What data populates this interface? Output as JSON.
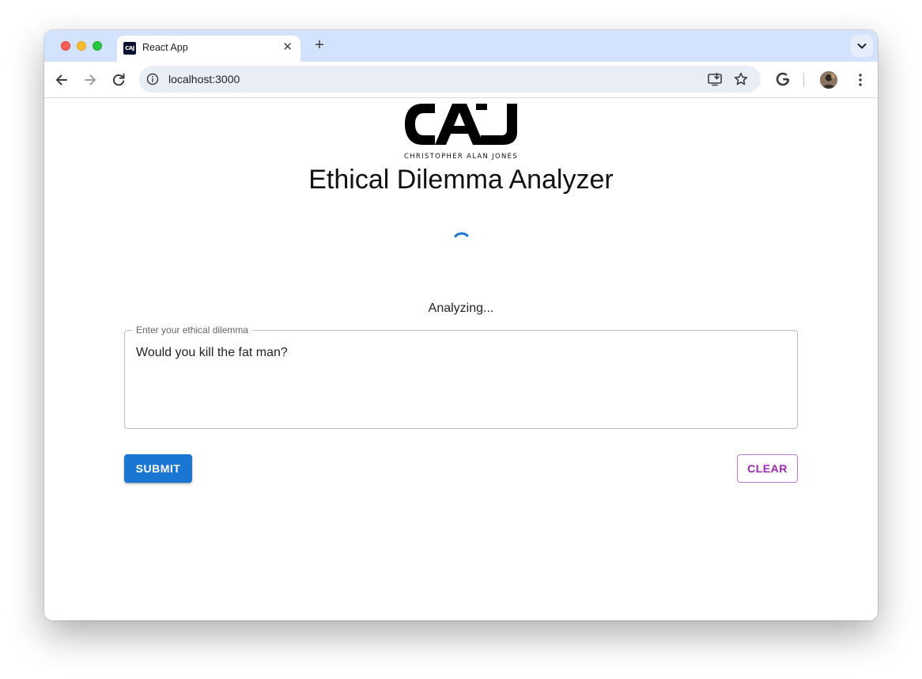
{
  "browser": {
    "tab_title": "React App",
    "tab_favicon_text": "CAJ",
    "close_symbol": "✕",
    "new_tab_symbol": "+",
    "url": "localhost:3000"
  },
  "app": {
    "logo_text": "CAJ",
    "logo_caption": "CHRISTOPHER ALAN JONES",
    "title": "Ethical Dilemma Analyzer",
    "status": "Analyzing...",
    "input_label": "Enter your ethical dilemma",
    "input_value": "Would you kill the fat man?",
    "submit_label": "SUBMIT",
    "clear_label": "CLEAR"
  },
  "colors": {
    "primary": "#1976d2",
    "secondary": "#9c27b0",
    "tabstrip": "#d3e3fd",
    "omnibox": "#e9eef6"
  },
  "icons": {
    "back": "back-arrow-icon",
    "forward": "forward-arrow-icon",
    "reload": "reload-icon",
    "info": "info-icon",
    "install": "install-app-icon",
    "bookmark": "star-icon",
    "google": "google-icon",
    "profile": "avatar",
    "menu": "kebab-menu-icon",
    "spinner": "spinner-icon"
  }
}
